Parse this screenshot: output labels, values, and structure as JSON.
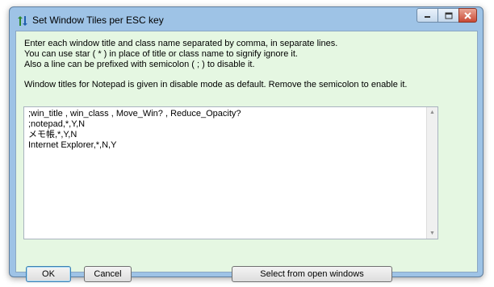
{
  "window": {
    "title": "Set Window Tiles per ESC key",
    "controls": [
      "minimize",
      "maximize",
      "close"
    ]
  },
  "instructions": {
    "line1": "Enter each window title and class name separated by comma, in separate lines.",
    "line2": "You can use star ( * ) in place of title or class name to signify ignore it.",
    "line3": "Also a line can be prefixed with semicolon ( ; ) to disable it.",
    "note": "Window titles for Notepad is given in disable mode as default. Remove the semicolon to enable it."
  },
  "editor": {
    "lines": [
      ";win_title , win_class , Move_Win? , Reduce_Opacity?",
      ";notepad,*,Y,N",
      "メモ帳,*,Y,N",
      "Internet Explorer,*,N,Y"
    ]
  },
  "buttons": {
    "ok": "OK",
    "cancel": "Cancel",
    "select": "Select from open windows"
  },
  "icons": {
    "app": "arrows-icon",
    "minimize": "minimize-icon",
    "maximize": "maximize-icon",
    "close": "close-icon"
  }
}
